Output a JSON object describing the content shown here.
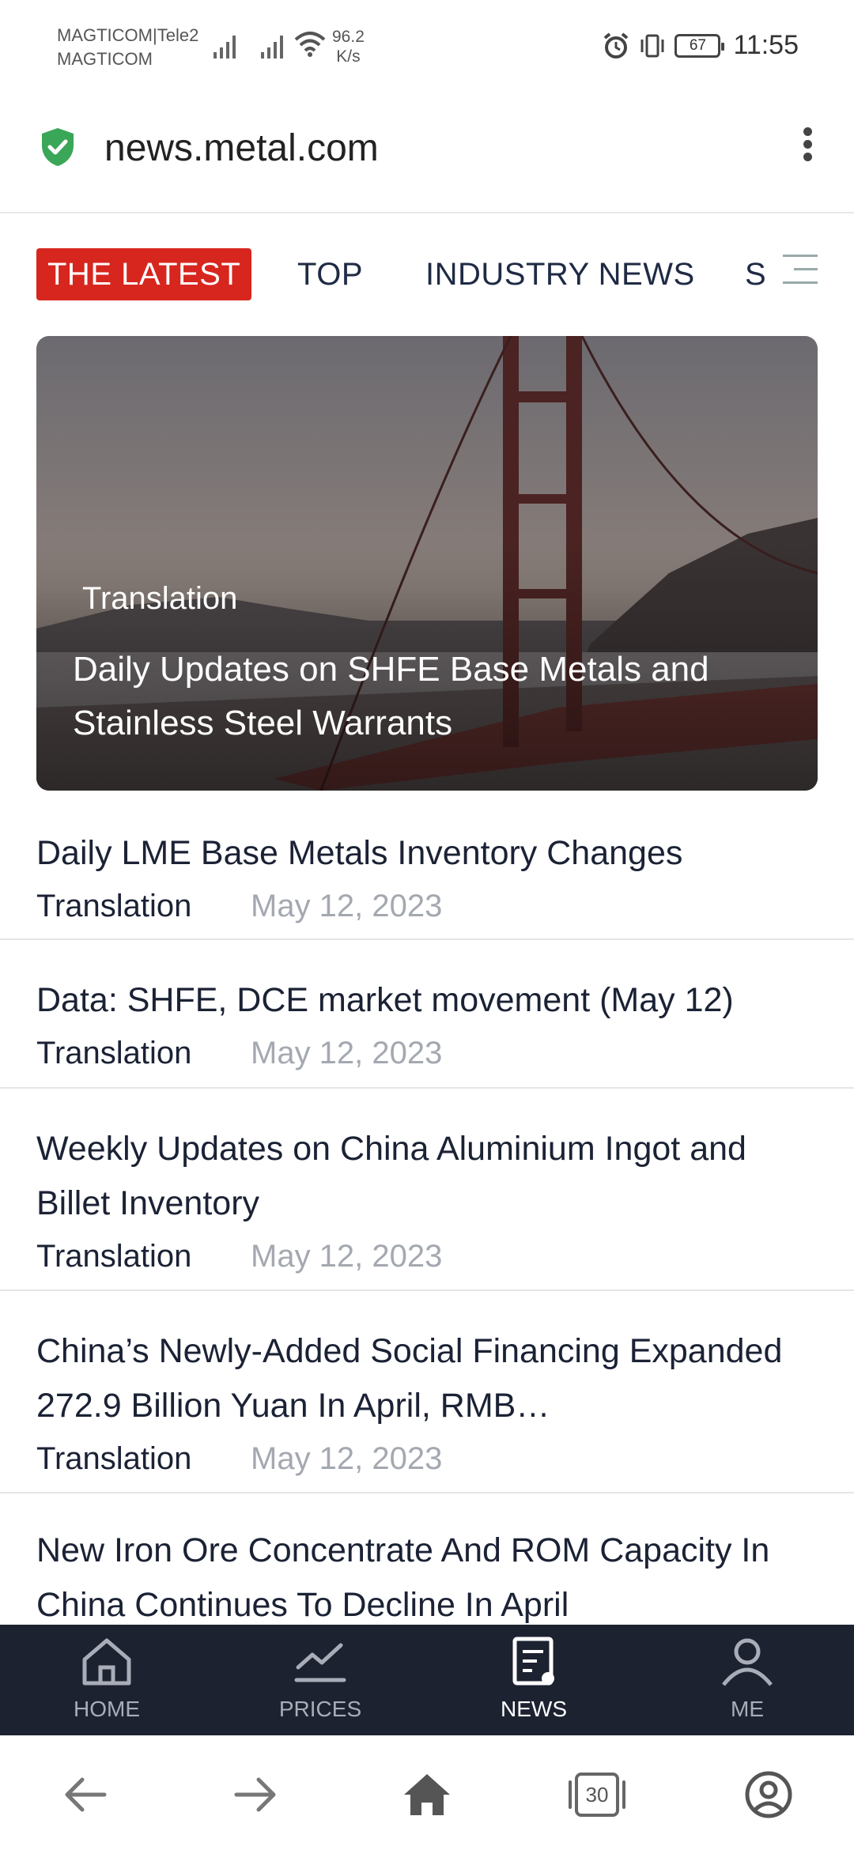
{
  "status_bar": {
    "carrier_line1": "MAGTICOM|Tele2",
    "carrier_line2": "MAGTICOM",
    "net_speed_value": "96.2",
    "net_speed_unit": "K/s",
    "battery": "67",
    "time": "11:55"
  },
  "browser": {
    "url": "news.metal.com"
  },
  "tabs": [
    {
      "label": "THE LATEST",
      "active": true
    },
    {
      "label": "TOP",
      "active": false
    },
    {
      "label": "INDUSTRY NEWS",
      "active": false
    },
    {
      "label": "S",
      "active": false
    }
  ],
  "hero": {
    "label": "Translation",
    "title": "Daily Updates on SHFE Base Metals and Stainless Steel Warrants"
  },
  "news": [
    {
      "title": "Daily LME Base Metals Inventory Changes",
      "source": "Translation",
      "date": "May 12, 2023"
    },
    {
      "title": "Data: SHFE, DCE market movement (May 12)",
      "source": "Translation",
      "date": "May 12, 2023"
    },
    {
      "title": "Weekly Updates on China Aluminium Ingot and Billet Inventory",
      "source": "Translation",
      "date": "May 12, 2023"
    },
    {
      "title": "China’s Newly-Added Social Financing Expanded 272.9 Billion Yuan In April, RMB…",
      "source": "Translation",
      "date": "May 12, 2023"
    },
    {
      "title": "New Iron Ore Concentrate And ROM Capacity In China Continues To Decline In April",
      "source": "",
      "date": ""
    }
  ],
  "app_nav": [
    {
      "label": "HOME",
      "icon": "home-icon",
      "active": false
    },
    {
      "label": "PRICES",
      "icon": "chart-icon",
      "active": false
    },
    {
      "label": "NEWS",
      "icon": "news-icon",
      "active": true
    },
    {
      "label": "ME",
      "icon": "user-icon",
      "active": false
    }
  ],
  "browser_bar": {
    "tab_count": "30"
  },
  "colors": {
    "accent_red": "#d7261e",
    "nav_bg": "#1d2231",
    "text_dark": "#1b2235",
    "date_gray": "#a4a8b0"
  }
}
